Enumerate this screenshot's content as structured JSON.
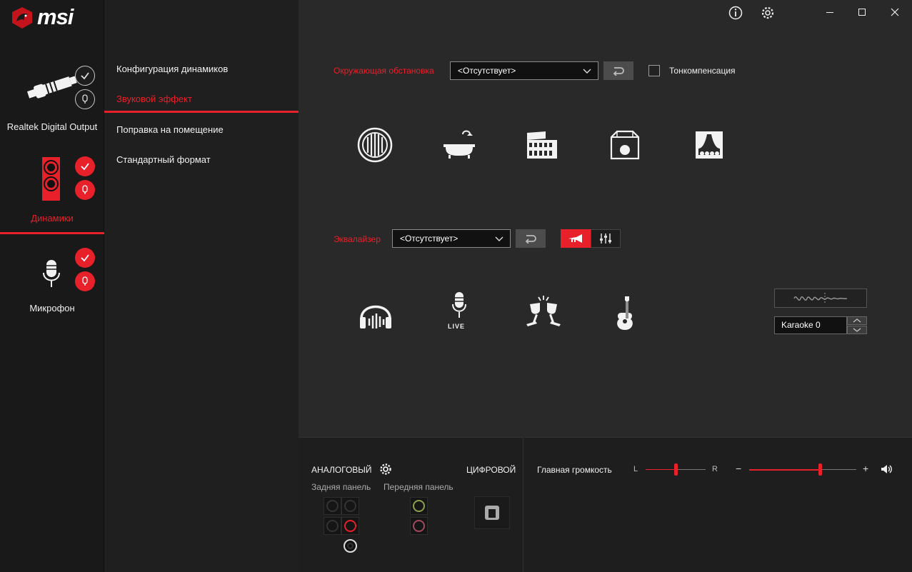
{
  "brand": {
    "logo_text": "msi"
  },
  "devices": [
    {
      "label": "Realtek Digital Output"
    },
    {
      "label": "Динамики"
    },
    {
      "label": "Микрофон"
    }
  ],
  "menu": {
    "items": [
      {
        "label": "Конфигурация динамиков"
      },
      {
        "label": "Звуковой эффект"
      },
      {
        "label": "Поправка на помещение"
      },
      {
        "label": "Стандартный формат"
      }
    ]
  },
  "environment": {
    "label": "Окружающая обстановка",
    "selected": "<Отсутствует>",
    "loudness_label": "Тонкомпенсация"
  },
  "equalizer": {
    "label": "Эквалайзер",
    "selected": "<Отсутствует>",
    "live_text": "LIVE",
    "karaoke_value": "Karaoke 0"
  },
  "bottom": {
    "analog_label": "АНАЛОГОВЫЙ",
    "digital_label": "ЦИФРОВОЙ",
    "rear_panel": "Задняя панель",
    "front_panel": "Передняя панель",
    "master_volume": "Главная громкость",
    "balance_left": "L",
    "balance_right": "R",
    "vol_minus": "−",
    "vol_plus": "+",
    "balance_level": 0.5,
    "volume_level": 0.66
  },
  "colors": {
    "accent": "#e8202a",
    "background": "#292929"
  }
}
